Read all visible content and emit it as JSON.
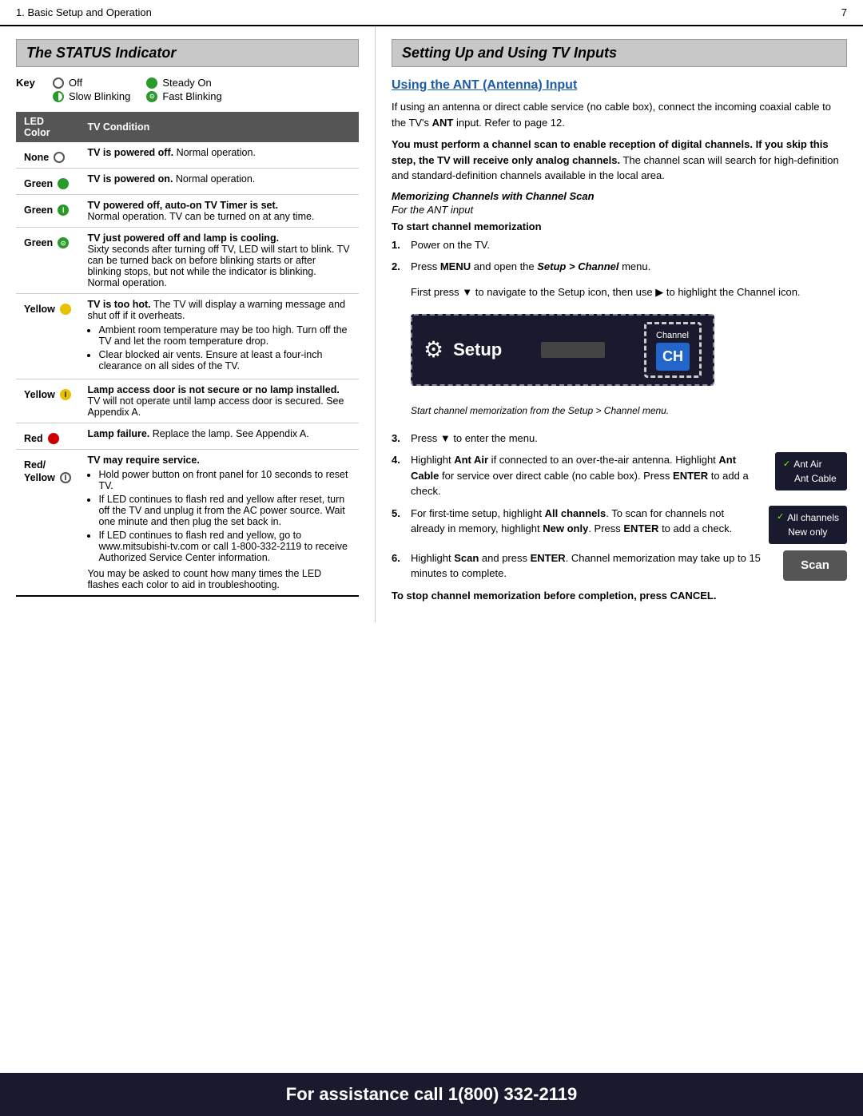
{
  "header": {
    "title": "1.  Basic Setup and Operation",
    "page_num": "7"
  },
  "left": {
    "section_title": "The STATUS Indicator",
    "key_label": "Key",
    "key_items": [
      {
        "icon": "empty-circle",
        "label": "Off"
      },
      {
        "icon": "green-solid",
        "label": "Steady On"
      },
      {
        "icon": "green-slow-blink",
        "label": "Slow Blinking"
      },
      {
        "icon": "green-fast-blink",
        "label": "Fast Blinking"
      }
    ],
    "table_headers": [
      "LED Color",
      "TV Condition"
    ],
    "table_rows": [
      {
        "color_label": "None",
        "icon": "empty-circle",
        "condition_bold": "TV is powered off.",
        "condition_rest": " Normal operation.",
        "sub_items": []
      },
      {
        "color_label": "Green",
        "icon": "green-solid",
        "condition_bold": "TV is powered on.",
        "condition_rest": " Normal operation.",
        "sub_items": []
      },
      {
        "color_label": "Green",
        "icon": "green-half-i",
        "condition_bold": "TV powered off, auto-on TV Timer is set.",
        "condition_rest": "\nNormal operation. TV can be turned on at any time.",
        "sub_items": []
      },
      {
        "color_label": "Green",
        "icon": "green-fast-blink",
        "condition_bold": "TV just powered off and lamp is cooling.",
        "condition_rest": "\nSixty seconds after turning off TV, LED will start to blink. TV can be turned back on before blinking starts or after blinking stops, but not while the indicator is blinking. Normal operation.",
        "sub_items": []
      },
      {
        "color_label": "Yellow",
        "icon": "yellow-solid",
        "condition_bold": "TV is too hot.",
        "condition_rest": " The TV will display a warning message and shut off if it overheats.",
        "sub_items": [
          "Ambient room temperature may be too high. Turn off the TV and let the room temperature drop.",
          "Clear blocked air vents. Ensure at least a four-inch clearance on all sides of the TV."
        ]
      },
      {
        "color_label": "Yellow",
        "icon": "yellow-i",
        "condition_bold": "Lamp access door is not secure or no lamp installed.",
        "condition_rest": "\nTV will not operate until lamp access door is secured. See Appendix A.",
        "sub_items": []
      },
      {
        "color_label": "Red",
        "icon": "red-solid",
        "condition_bold": "Lamp failure.",
        "condition_rest": " Replace the lamp. See Appendix A.",
        "sub_items": []
      },
      {
        "color_label": "Red/ Yellow",
        "icon": "circle-i",
        "condition_bold": "TV may require service.",
        "condition_rest": "",
        "sub_items": [
          "Hold power button on front panel for 10 seconds to reset TV.",
          "If LED continues to flash red and yellow after reset, turn off the TV and unplug it from the AC power source. Wait one minute and then plug the set back in.",
          "If LED continues to flash red and yellow, go to www.mitsubishi-tv.com or call 1-800-332-2119 to receive Authorized Service Center information.",
          "You may be asked to count how many times the LED flashes each color to aid in troubleshooting."
        ]
      }
    ]
  },
  "right": {
    "section_title": "Setting Up and Using TV Inputs",
    "ant_title": "Using the ANT (Antenna) Input",
    "para1": "If using an antenna or direct cable service (no cable box), connect the incoming coaxial cable to the TV’s ANT input.  Refer to page 12.",
    "para2_bold": "You must perform a channel scan to enable reception of digital channels.  If you skip this step, the TV will receive only analog channels.",
    "para2_rest": "  The channel scan will search for high-definition and standard-definition channels available in the local area.",
    "memorizing_title": "Memorizing Channels with Channel Scan",
    "ant_input_label": "For the ANT input",
    "start_label": "To start channel memorization",
    "step1": "Power on the TV.",
    "step2_start": "Press ",
    "step2_bold": "MENU",
    "step2_mid": " and open the ",
    "step2_italic_bold": "Setup > Channel",
    "step2_end": " menu.",
    "step2_sub": "First press ▼ to navigate to the Setup icon, then use ► to highlight the Channel icon.",
    "setup_label": "Setup",
    "setup_channel_label": "Channel",
    "setup_ch_label": "CH",
    "setup_caption": "Start channel memorization from the Setup > Channel menu.",
    "step3": "Press ▼ to enter the menu.",
    "step4_start": "Highlight ",
    "step4_bold1": "Ant Air",
    "step4_mid1": " if connected to an over-the-air antenna. Highlight ",
    "step4_bold2": "Ant Cable",
    "step4_mid2": " for service over direct cable (no cable box). Press ",
    "step4_bold3": "ENTER",
    "step4_end": " to add a check.",
    "ant_air_label": "✓ Ant Air",
    "ant_cable_label": "Ant Cable",
    "step5_start": "For first-time setup, highlight ",
    "step5_bold1": "All channels",
    "step5_mid1": ". To scan for channels not already in memory, highlight ",
    "step5_bold2": "New only",
    "step5_mid2": ". Press ",
    "step5_bold3": "ENTER",
    "step5_end": " to add a check.",
    "all_channels_label": "✓ All channels",
    "new_only_label": "New only",
    "step6_start": "Highlight ",
    "step6_bold1": "Scan",
    "step6_mid": " and press ",
    "step6_bold2": "ENTER",
    "step6_end": ". Channel memorization may take up to 15 minutes to complete.",
    "scan_label": "Scan",
    "stop_note": "To stop channel memorization before completion, press ",
    "stop_bold": "CANCEL",
    "stop_period": "."
  },
  "footer": {
    "text": "For assistance call 1(800) 332-2119"
  }
}
